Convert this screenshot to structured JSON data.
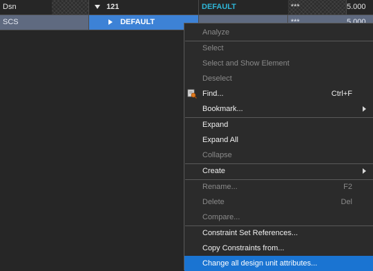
{
  "grid": {
    "header": {
      "name": "Dsn",
      "expander": "121",
      "value": "DEFAULT",
      "stars": "***",
      "number": "5.000"
    },
    "row": {
      "name": "SCS",
      "child": "DEFAULT",
      "stars": "***",
      "number": "5.000"
    }
  },
  "menu": {
    "items": [
      {
        "label": "Analyze",
        "enabled": false
      },
      {
        "label": "Select",
        "enabled": false
      },
      {
        "label": "Select and Show Element",
        "enabled": false
      },
      {
        "label": "Deselect",
        "enabled": false
      },
      {
        "label": "Find...",
        "shortcut": "Ctrl+F",
        "enabled": true,
        "icon": "find-icon"
      },
      {
        "label": "Bookmark...",
        "enabled": true,
        "submenu": true
      },
      {
        "label": "Expand",
        "enabled": true
      },
      {
        "label": "Expand All",
        "enabled": true
      },
      {
        "label": "Collapse",
        "enabled": false
      },
      {
        "label": "Create",
        "enabled": true,
        "submenu": true
      },
      {
        "label": "Rename...",
        "shortcut": "F2",
        "enabled": false
      },
      {
        "label": "Delete",
        "shortcut": "Del",
        "enabled": false
      },
      {
        "label": "Compare...",
        "enabled": false
      },
      {
        "label": "Constraint Set References...",
        "enabled": true
      },
      {
        "label": "Copy Constraints from...",
        "enabled": true
      },
      {
        "label": "Change all design unit attributes...",
        "enabled": true,
        "highlighted": true
      }
    ]
  },
  "colors": {
    "highlight": "#1a74d2",
    "selected_cell": "#3d82d6",
    "teal_text": "#2fb5d6",
    "background": "#262626"
  }
}
